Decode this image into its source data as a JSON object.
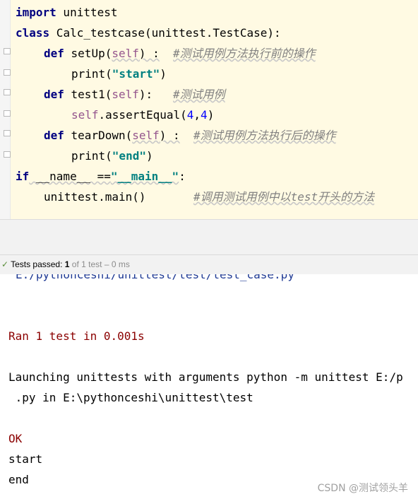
{
  "editor": {
    "lines": {
      "l1": {
        "kw": "import",
        "rest": " unittest"
      },
      "l2": {
        "kw": "class",
        "rest": " Calc_testcase(unittest.TestCase):"
      },
      "l3": {
        "kw": "def",
        "name": " setUp(",
        "self": "self",
        "tail": ") :",
        "comment": "#测试用例方法执行前的操作"
      },
      "l4": {
        "fn": "print(",
        "str": "\"start\"",
        "close": ")"
      },
      "l5": {
        "kw": "def",
        "name": " test1(",
        "self": "self",
        "tail": "):",
        "comment": "#测试用例"
      },
      "l6": {
        "self": "self",
        "call": ".assertEqual(",
        "n1": "4",
        "comma": ",",
        "n2": "4",
        "close": ")"
      },
      "l7": {
        "kw": "def",
        "name": " tearDown(",
        "self": "self",
        "tail": ") :",
        "comment": "#测试用例方法执行后的操作"
      },
      "l8": {
        "fn": "print(",
        "str": "\"end\"",
        "close": ")"
      },
      "l9": {
        "kw": "if",
        "mid": " __name__ ==",
        "str": "\"__main__\"",
        "tail": ":"
      },
      "l10": {
        "call": "unittest.main()",
        "comment": "#调用测试用例中以test开头的方法"
      }
    }
  },
  "status_bar": {
    "check": "✓",
    "label": "Tests passed: ",
    "count": "1",
    "of": " of 1 test – 0 ms"
  },
  "console": {
    "path_cut": "E:/pythonceshi/unittest/test/test_case.py",
    "ran": "Ran 1 test in 0.001s",
    "launch1": "Launching unittests with arguments python -m unittest E:/p",
    "launch2": " .py in E:\\pythonceshi\\unittest\\test",
    "ok": "OK",
    "out1": "start",
    "out2": "end"
  },
  "watermark": "CSDN @测试领头羊"
}
